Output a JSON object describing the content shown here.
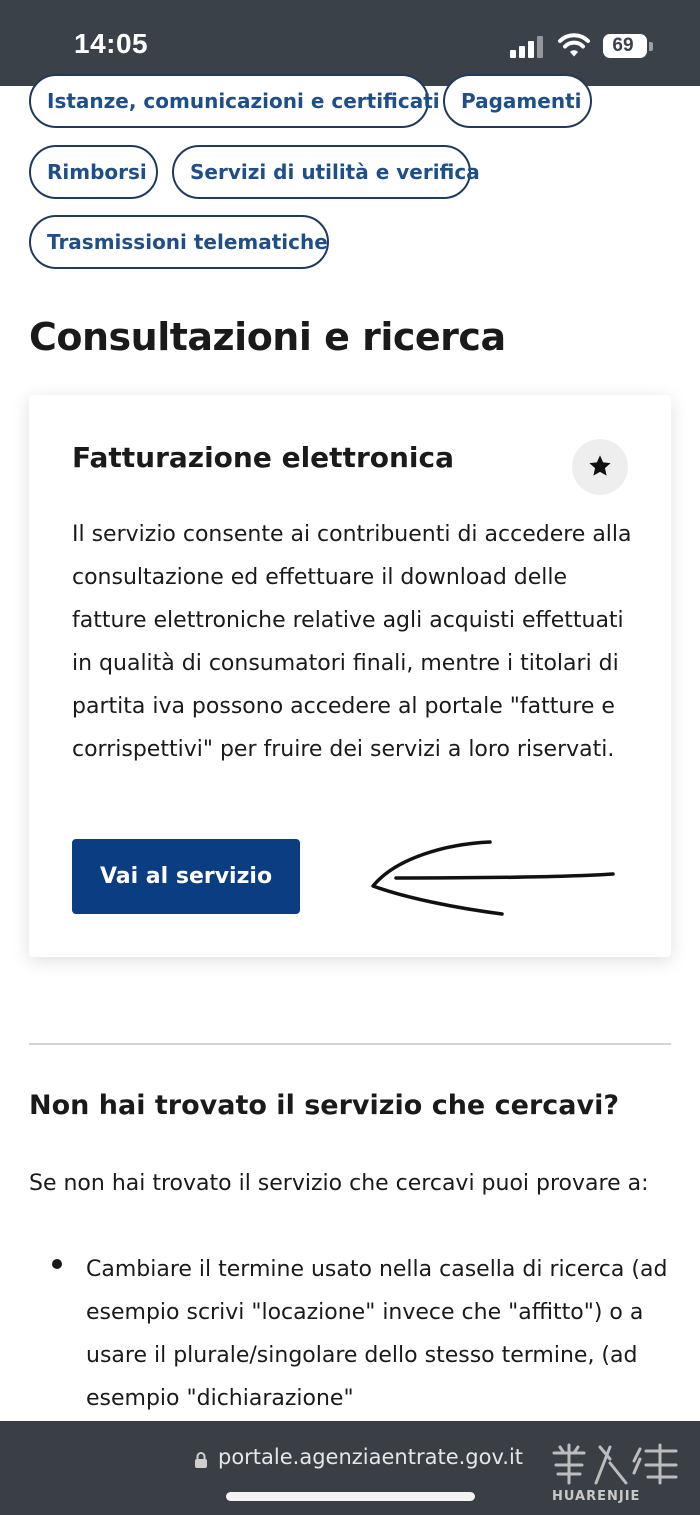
{
  "status_bar": {
    "time": "14:05",
    "battery_level": "69",
    "icons": [
      "signal-icon",
      "wifi-icon",
      "battery-icon"
    ]
  },
  "categories": [
    "Istanze, comunicazioni e certificati",
    "Pagamenti",
    "Rimborsi",
    "Servizi di utilità e verifica",
    "Trasmissioni telematiche"
  ],
  "section": {
    "title": "Consultazioni e ricerca"
  },
  "card": {
    "title": "Fatturazione elettronica",
    "favorite_icon": "star-icon",
    "description": "Il servizio consente ai contribuenti di accedere alla consultazione ed effettuare il download delle fatture elettroniche relative agli acquisti effettuati in qualità di consumatori finali, mentre i titolari di partita iva possono accedere al portale \"fatture e corrispettivi\" per fruire dei servizi a loro riservati.",
    "button_label": "Vai al servizio",
    "annotation_icon": "hand-drawn-arrow-icon"
  },
  "help": {
    "title": "Non hai trovato il servizio che cercavi?",
    "intro": "Se non hai trovato il servizio che cercavi puoi provare a:",
    "items": [
      "Cambiare il termine usato nella casella di ricerca (ad esempio scrivi \"locazione\" invece che \"affitto\") o a usare il plurale/singolare dello stesso termine, (ad esempio \"dichiarazione\""
    ]
  },
  "browser": {
    "url": "portale.agenziaentrate.gov.it",
    "lock_icon": "lock-icon"
  },
  "watermark": {
    "text": "HUARENJIE"
  },
  "colors": {
    "status_bar": "#3b4149",
    "chip_border": "#1f3a5c",
    "chip_text": "#1f4f88",
    "primary_button": "#0a3d82",
    "browser_bar": "#3a3f46"
  }
}
